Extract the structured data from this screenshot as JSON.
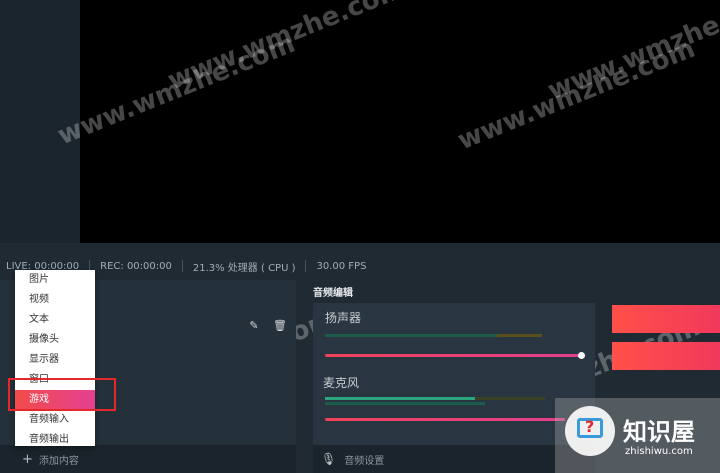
{
  "watermarks": [
    "www.wmzhe.com",
    "www.wmzhe.com",
    "www.wmzhe.com",
    "www.wmzhe.com",
    "www.wmzhe.com",
    "www.wmzhe.com"
  ],
  "status": {
    "live": "LIVE: 00:00:00",
    "rec": "REC: 00:00:00",
    "cpu": "21.3% 处理器 ( CPU )",
    "fps": "30.00 FPS"
  },
  "add_menu": {
    "items": [
      "图片",
      "视频",
      "文本",
      "摄像头",
      "显示器",
      "窗口",
      "游戏",
      "音频输入",
      "音频输出"
    ],
    "active_index": 6
  },
  "sources": {
    "add_label": "添加内容",
    "icons": [
      "edit-icon",
      "trash-icon"
    ]
  },
  "audio": {
    "title": "音频编辑",
    "channels": [
      {
        "name": "扬声器",
        "volume": 1.0
      },
      {
        "name": "麦克风",
        "volume": 1.0
      }
    ],
    "settings_label": "音频设置"
  },
  "colors": {
    "accent": "#f0435a",
    "button": "#ff5049"
  },
  "logo": {
    "text": "知识屋",
    "sub": "zhishiwu.com"
  }
}
